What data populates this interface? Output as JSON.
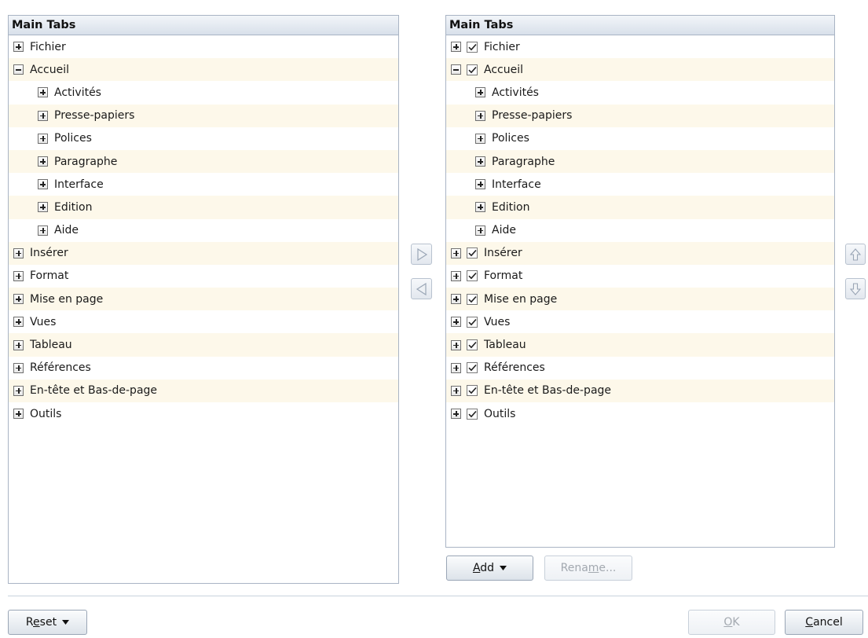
{
  "left_panel": {
    "header": "Main Tabs",
    "items": [
      {
        "label": "Fichier",
        "level": 0,
        "expander": "plus"
      },
      {
        "label": "Accueil",
        "level": 0,
        "expander": "minus"
      },
      {
        "label": "Activités",
        "level": 1,
        "expander": "plus"
      },
      {
        "label": "Presse-papiers",
        "level": 1,
        "expander": "plus"
      },
      {
        "label": "Polices",
        "level": 1,
        "expander": "plus"
      },
      {
        "label": "Paragraphe",
        "level": 1,
        "expander": "plus"
      },
      {
        "label": "Interface",
        "level": 1,
        "expander": "plus"
      },
      {
        "label": "Edition",
        "level": 1,
        "expander": "plus"
      },
      {
        "label": "Aide",
        "level": 1,
        "expander": "plus"
      },
      {
        "label": "Insérer",
        "level": 0,
        "expander": "plus"
      },
      {
        "label": "Format",
        "level": 0,
        "expander": "plus"
      },
      {
        "label": "Mise en page",
        "level": 0,
        "expander": "plus"
      },
      {
        "label": "Vues",
        "level": 0,
        "expander": "plus"
      },
      {
        "label": "Tableau",
        "level": 0,
        "expander": "plus"
      },
      {
        "label": "Références",
        "level": 0,
        "expander": "plus"
      },
      {
        "label": "En-tête et Bas-de-page",
        "level": 0,
        "expander": "plus"
      },
      {
        "label": "Outils",
        "level": 0,
        "expander": "plus"
      }
    ]
  },
  "right_panel": {
    "header": "Main Tabs",
    "items": [
      {
        "label": "Fichier",
        "level": 0,
        "expander": "plus",
        "checked": true
      },
      {
        "label": "Accueil",
        "level": 0,
        "expander": "minus",
        "checked": true
      },
      {
        "label": "Activités",
        "level": 1,
        "expander": "plus"
      },
      {
        "label": "Presse-papiers",
        "level": 1,
        "expander": "plus"
      },
      {
        "label": "Polices",
        "level": 1,
        "expander": "plus"
      },
      {
        "label": "Paragraphe",
        "level": 1,
        "expander": "plus"
      },
      {
        "label": "Interface",
        "level": 1,
        "expander": "plus"
      },
      {
        "label": "Edition",
        "level": 1,
        "expander": "plus"
      },
      {
        "label": "Aide",
        "level": 1,
        "expander": "plus"
      },
      {
        "label": "Insérer",
        "level": 0,
        "expander": "plus",
        "checked": true
      },
      {
        "label": "Format",
        "level": 0,
        "expander": "plus",
        "checked": true
      },
      {
        "label": "Mise en page",
        "level": 0,
        "expander": "plus",
        "checked": true
      },
      {
        "label": "Vues",
        "level": 0,
        "expander": "plus",
        "checked": true
      },
      {
        "label": "Tableau",
        "level": 0,
        "expander": "plus",
        "checked": true
      },
      {
        "label": "Références",
        "level": 0,
        "expander": "plus",
        "checked": true
      },
      {
        "label": "En-tête et Bas-de-page",
        "level": 0,
        "expander": "plus",
        "checked": true
      },
      {
        "label": "Outils",
        "level": 0,
        "expander": "plus",
        "checked": true
      }
    ]
  },
  "buttons": {
    "add": {
      "label": "Add",
      "mnemonic": "A",
      "rest": "dd"
    },
    "rename": {
      "label": "Rename...",
      "before": "Rena",
      "mnemonic": "m",
      "rest": "e..."
    },
    "reset": {
      "label": "Reset",
      "before": "R",
      "mnemonic": "e",
      "rest": "set"
    },
    "ok": {
      "label": "OK",
      "mnemonic": "O",
      "rest": "K"
    },
    "cancel": {
      "label": "Cancel",
      "mnemonic": "C",
      "rest": "ancel"
    }
  },
  "icons": {
    "expander_plus": "plus-box-icon",
    "expander_minus": "minus-box-icon",
    "checkbox": "checkmark-icon",
    "add_to_right": "triangle-right-icon",
    "remove_from_right": "triangle-left-icon",
    "move_up": "arrow-up-icon",
    "move_down": "arrow-down-icon",
    "dropdown": "triangle-down-icon"
  },
  "colors": {
    "row_alt": "#fdf8ea",
    "border": "#a9b4c4",
    "disabled_text": "#a3a9b0"
  }
}
